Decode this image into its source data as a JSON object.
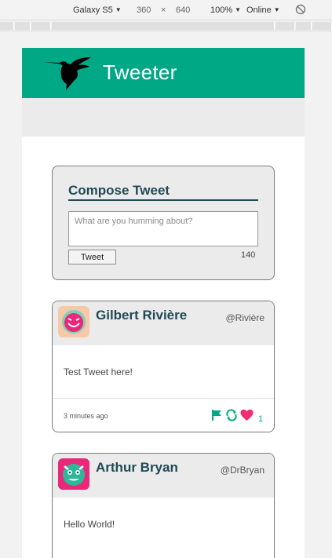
{
  "devtools": {
    "device": "Galaxy S5",
    "width": "360",
    "times": "×",
    "height": "640",
    "zoom": "100%",
    "network": "Online"
  },
  "app": {
    "title": "Tweeter",
    "brand_color": "#00a885",
    "heading_color": "#1f4a56"
  },
  "compose": {
    "title": "Compose Tweet",
    "placeholder": "What are you humming about?",
    "button_label": "Tweet",
    "char_count": "140"
  },
  "tweets": [
    {
      "name": "Gilbert Rivière",
      "handle": "@Rivière",
      "text": "Test Tweet here!",
      "time": "3 minutes ago",
      "likes": "1",
      "avatar": "pink-smiley-avatar"
    },
    {
      "name": "Arthur Bryan",
      "handle": "@DrBryan",
      "text": "Hello World!",
      "avatar": "pink-monster-avatar"
    }
  ]
}
